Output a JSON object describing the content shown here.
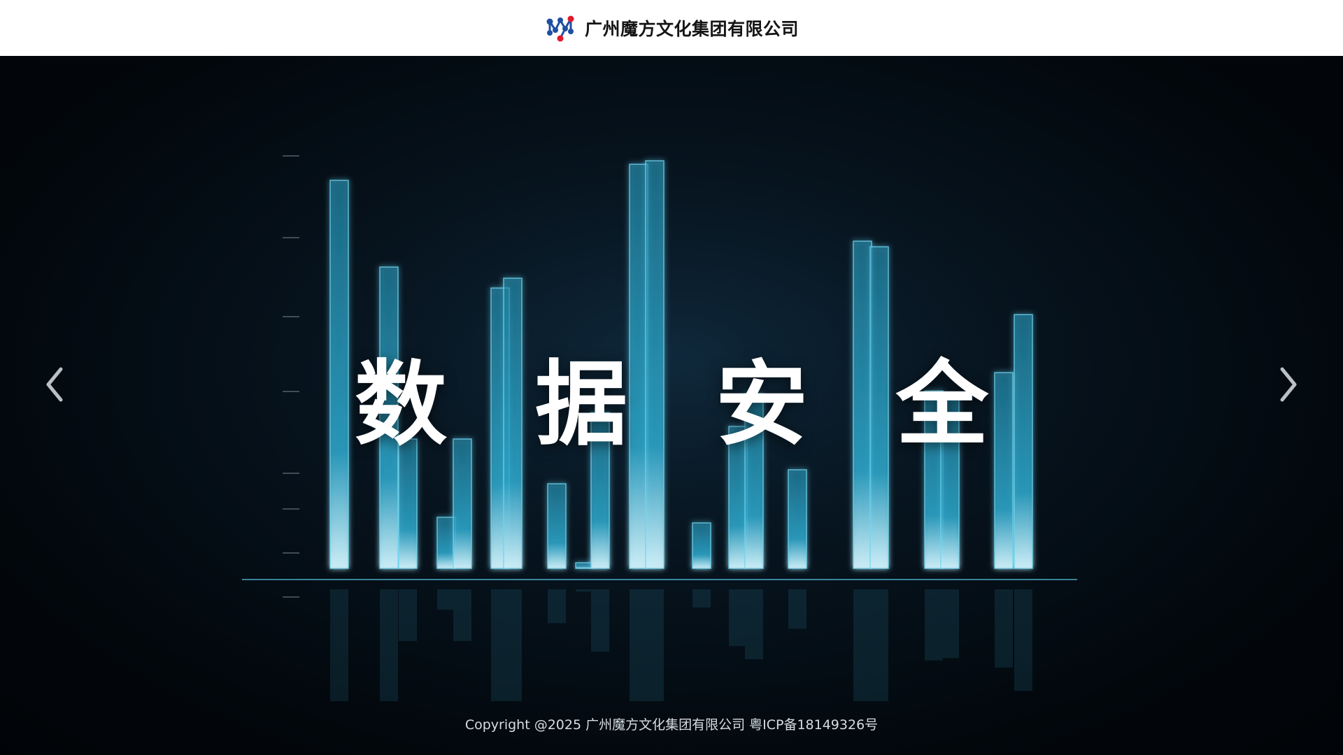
{
  "header": {
    "company_name": "广州魔方文化集团有限公司",
    "logo_icon": "molecule-logo-icon"
  },
  "hero": {
    "title": "数 据 安 全",
    "prev_icon": "chevron-left-icon",
    "next_icon": "chevron-right-icon"
  },
  "footer": {
    "copyright": "Copyright @2025 广州魔方文化集团有限公司 粤ICP备18149326号"
  },
  "colors": {
    "header_bg": "#ffffff",
    "hero_bg": "#02070c",
    "bar_glow": "#3fb6d8",
    "logo_blue": "#1f4fa3",
    "logo_red": "#e3182d"
  }
}
